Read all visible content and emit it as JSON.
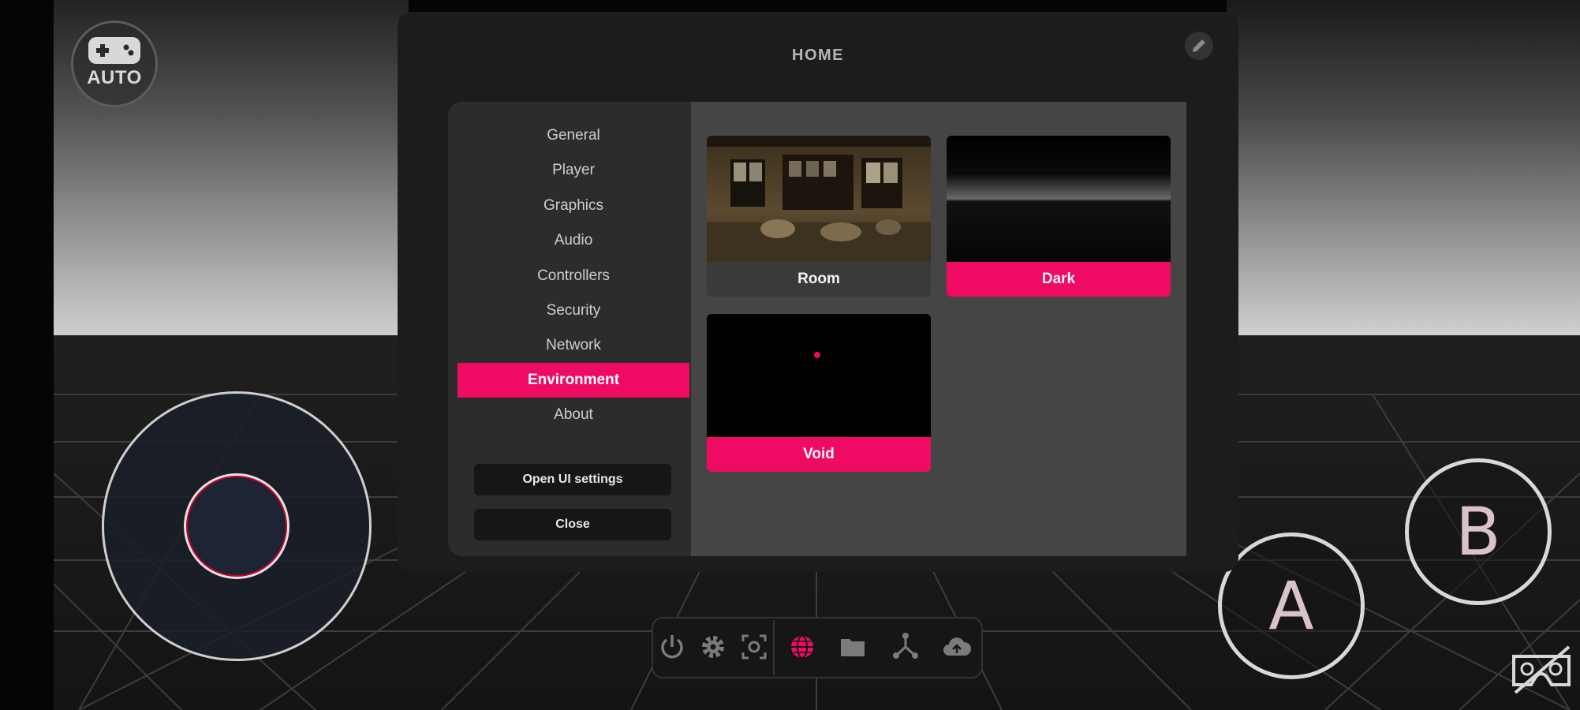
{
  "hud": {
    "auto_label": "AUTO",
    "button_a": "A",
    "button_b": "B"
  },
  "panel": {
    "title": "HOME",
    "sidebar": {
      "items": [
        {
          "label": "General",
          "active": false
        },
        {
          "label": "Player",
          "active": false
        },
        {
          "label": "Graphics",
          "active": false
        },
        {
          "label": "Audio",
          "active": false
        },
        {
          "label": "Controllers",
          "active": false
        },
        {
          "label": "Security",
          "active": false
        },
        {
          "label": "Network",
          "active": false
        },
        {
          "label": "Environment",
          "active": true
        },
        {
          "label": "About",
          "active": false
        }
      ],
      "open_ui_settings": "Open UI settings",
      "close": "Close"
    },
    "environments": [
      {
        "label": "Room",
        "selected": false
      },
      {
        "label": "Dark",
        "selected": true
      },
      {
        "label": "Void",
        "selected": true
      }
    ]
  },
  "toolbar": {
    "icons": [
      "power-icon",
      "gear-icon",
      "recenter-icon",
      "globe-icon",
      "folder-icon",
      "share-icon",
      "cloud-upload-icon"
    ],
    "active": "globe-icon"
  },
  "colors": {
    "accent": "#ef0b63",
    "panel": "#1c1c1c",
    "sidebar": "#2c2c2c",
    "content": "#454545"
  }
}
